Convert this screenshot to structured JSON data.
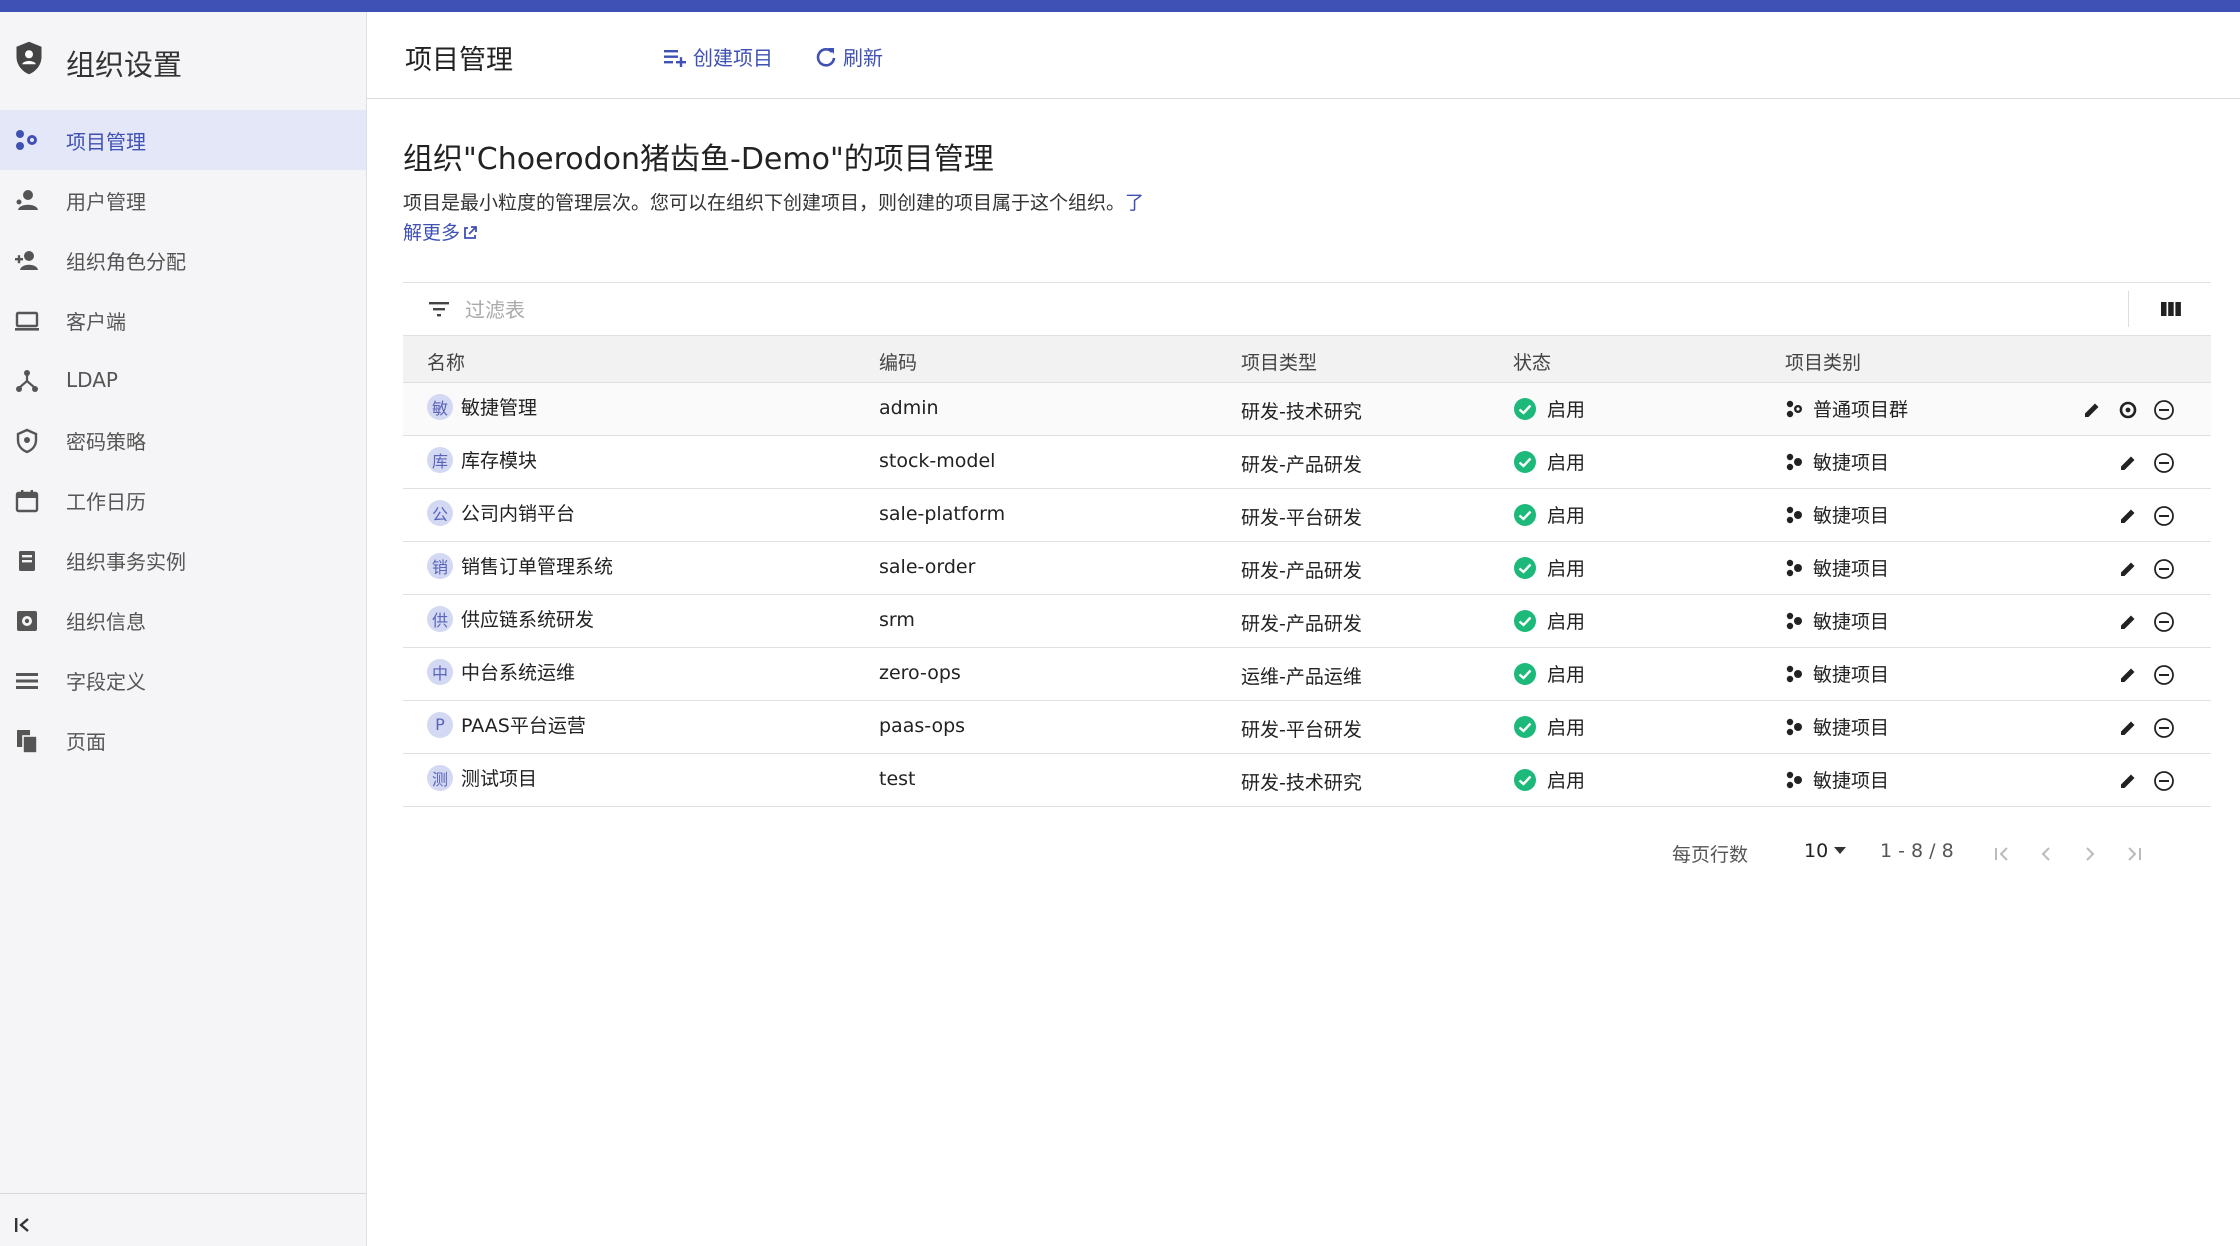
{
  "sidebar": {
    "title": "组织设置",
    "items": [
      {
        "label": "项目管理",
        "icon": "project-icon",
        "active": true
      },
      {
        "label": "用户管理",
        "icon": "user-icon"
      },
      {
        "label": "组织角色分配",
        "icon": "person-add-icon"
      },
      {
        "label": "客户端",
        "icon": "laptop-icon"
      },
      {
        "label": "LDAP",
        "icon": "ldap-icon"
      },
      {
        "label": "密码策略",
        "icon": "shield-icon"
      },
      {
        "label": "工作日历",
        "icon": "calendar-icon"
      },
      {
        "label": "组织事务实例",
        "icon": "book-icon"
      },
      {
        "label": "组织信息",
        "icon": "gear-box-icon"
      },
      {
        "label": "字段定义",
        "icon": "list-icon"
      },
      {
        "label": "页面",
        "icon": "pages-icon"
      }
    ]
  },
  "header": {
    "title": "项目管理",
    "create_label": "创建项目",
    "refresh_label": "刷新"
  },
  "content": {
    "title": "组织\"Choerodon猪齿鱼-Demo\"的项目管理",
    "desc": "项目是最小粒度的管理层次。您可以在组织下创建项目，则创建的项目属于这个组织。",
    "link_part1": "了",
    "link_part2": "解更多"
  },
  "table": {
    "filter_placeholder": "过滤表",
    "columns": [
      "名称",
      "编码",
      "项目类型",
      "状态",
      "项目类别"
    ],
    "rows": [
      {
        "avatar": "敏",
        "name": "敏捷管理",
        "code": "admin",
        "type": "研发-技术研究",
        "status": "启用",
        "category": "普通项目群"
      },
      {
        "avatar": "库",
        "name": "库存模块",
        "code": "stock-model",
        "type": "研发-产品研发",
        "status": "启用",
        "category": "敏捷项目"
      },
      {
        "avatar": "公",
        "name": "公司内销平台",
        "code": "sale-platform",
        "type": "研发-平台研发",
        "status": "启用",
        "category": "敏捷项目"
      },
      {
        "avatar": "销",
        "name": "销售订单管理系统",
        "code": "sale-order",
        "type": "研发-产品研发",
        "status": "启用",
        "category": "敏捷项目"
      },
      {
        "avatar": "供",
        "name": "供应链系统研发",
        "code": "srm",
        "type": "研发-产品研发",
        "status": "启用",
        "category": "敏捷项目"
      },
      {
        "avatar": "中",
        "name": "中台系统运维",
        "code": "zero-ops",
        "type": "运维-产品运维",
        "status": "启用",
        "category": "敏捷项目"
      },
      {
        "avatar": "P",
        "name": "PAAS平台运营",
        "code": "paas-ops",
        "type": "研发-平台研发",
        "status": "启用",
        "category": "敏捷项目"
      },
      {
        "avatar": "测",
        "name": "测试项目",
        "code": "test",
        "type": "研发-技术研究",
        "status": "启用",
        "category": "敏捷项目"
      }
    ]
  },
  "pagination": {
    "rows_per_page_label": "每页行数",
    "page_size": "10",
    "range": "1 - 8 / 8"
  },
  "colors": {
    "accent": "#3f51b5",
    "status_ok": "#1db97a",
    "active_bg": "#e3e7f8"
  }
}
